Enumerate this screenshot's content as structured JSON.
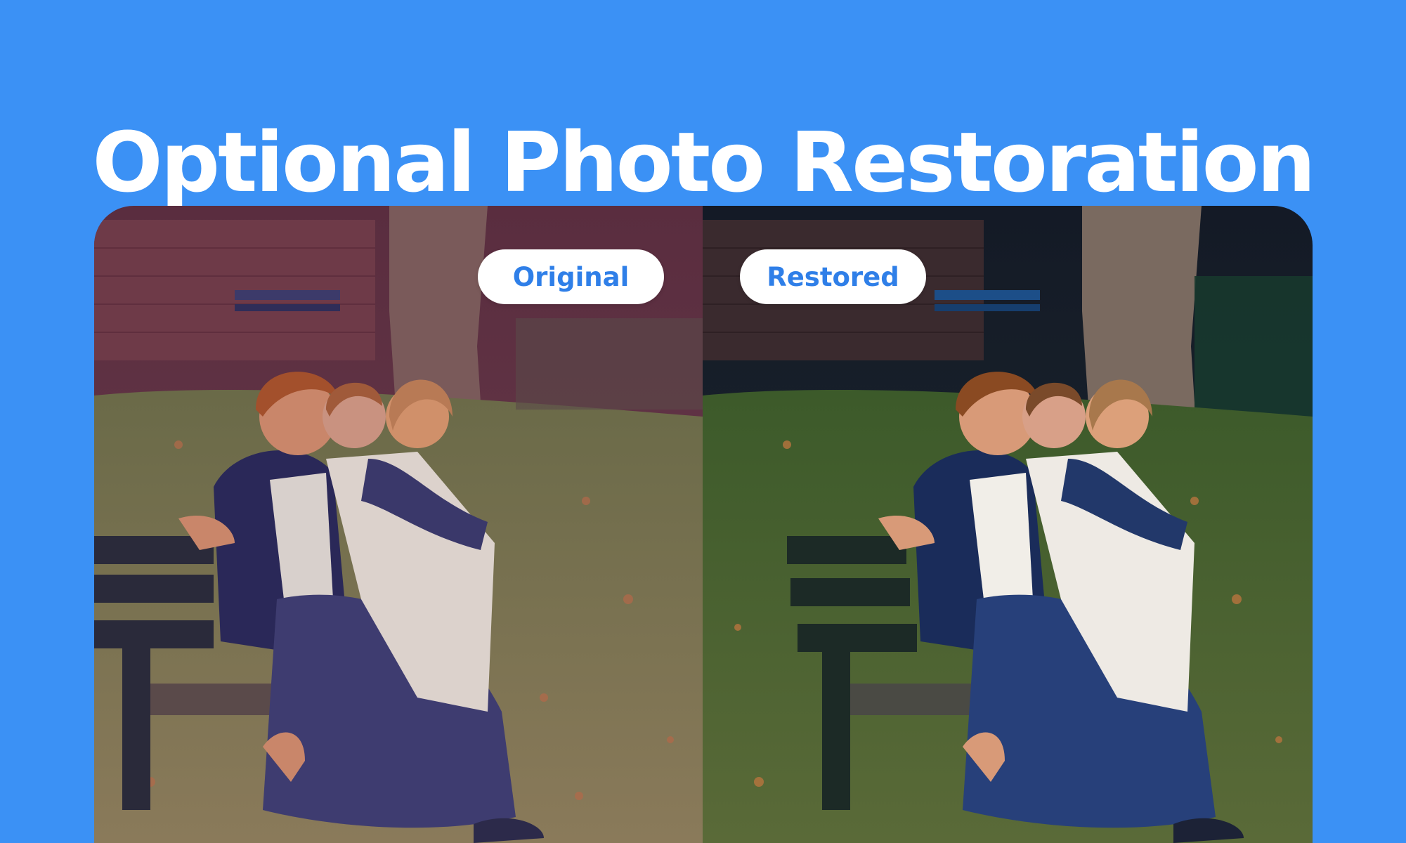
{
  "headline": "Optional Photo Restoration",
  "labels": {
    "original": "Original",
    "restored": "Restored"
  },
  "colors": {
    "background": "#3b91f5",
    "pill_text": "#2f7fe8",
    "pill_bg": "#ffffff"
  }
}
